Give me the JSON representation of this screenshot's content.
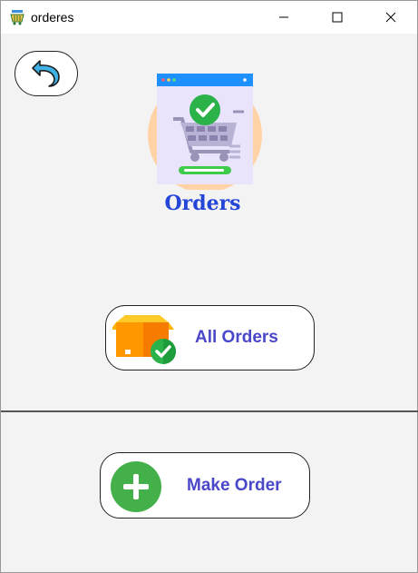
{
  "window": {
    "title": "orderes"
  },
  "header": {
    "title": "Orders",
    "back_icon": "back-arrow-icon",
    "hero_icon": "shopping-cart-check-icon"
  },
  "buttons": {
    "all_orders": {
      "label": "All Orders",
      "icon": "box-check-icon"
    },
    "make_order": {
      "label": "Make Order",
      "icon": "plus-circle-icon"
    }
  },
  "colors": {
    "title": "#2446d8",
    "button_label": "#4a47c8",
    "plus_green": "#43b04a",
    "background": "#f3f3f3"
  }
}
